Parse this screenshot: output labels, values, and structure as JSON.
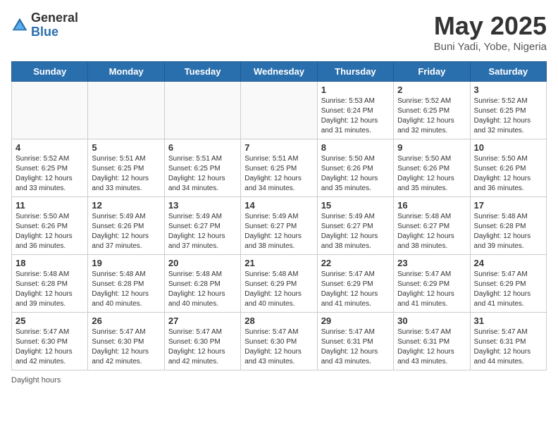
{
  "header": {
    "logo_general": "General",
    "logo_blue": "Blue",
    "month": "May 2025",
    "location": "Buni Yadi, Yobe, Nigeria"
  },
  "weekdays": [
    "Sunday",
    "Monday",
    "Tuesday",
    "Wednesday",
    "Thursday",
    "Friday",
    "Saturday"
  ],
  "weeks": [
    [
      {
        "day": "",
        "info": ""
      },
      {
        "day": "",
        "info": ""
      },
      {
        "day": "",
        "info": ""
      },
      {
        "day": "",
        "info": ""
      },
      {
        "day": "1",
        "info": "Sunrise: 5:53 AM\nSunset: 6:24 PM\nDaylight: 12 hours and 31 minutes."
      },
      {
        "day": "2",
        "info": "Sunrise: 5:52 AM\nSunset: 6:25 PM\nDaylight: 12 hours and 32 minutes."
      },
      {
        "day": "3",
        "info": "Sunrise: 5:52 AM\nSunset: 6:25 PM\nDaylight: 12 hours and 32 minutes."
      }
    ],
    [
      {
        "day": "4",
        "info": "Sunrise: 5:52 AM\nSunset: 6:25 PM\nDaylight: 12 hours and 33 minutes."
      },
      {
        "day": "5",
        "info": "Sunrise: 5:51 AM\nSunset: 6:25 PM\nDaylight: 12 hours and 33 minutes."
      },
      {
        "day": "6",
        "info": "Sunrise: 5:51 AM\nSunset: 6:25 PM\nDaylight: 12 hours and 34 minutes."
      },
      {
        "day": "7",
        "info": "Sunrise: 5:51 AM\nSunset: 6:25 PM\nDaylight: 12 hours and 34 minutes."
      },
      {
        "day": "8",
        "info": "Sunrise: 5:50 AM\nSunset: 6:26 PM\nDaylight: 12 hours and 35 minutes."
      },
      {
        "day": "9",
        "info": "Sunrise: 5:50 AM\nSunset: 6:26 PM\nDaylight: 12 hours and 35 minutes."
      },
      {
        "day": "10",
        "info": "Sunrise: 5:50 AM\nSunset: 6:26 PM\nDaylight: 12 hours and 36 minutes."
      }
    ],
    [
      {
        "day": "11",
        "info": "Sunrise: 5:50 AM\nSunset: 6:26 PM\nDaylight: 12 hours and 36 minutes."
      },
      {
        "day": "12",
        "info": "Sunrise: 5:49 AM\nSunset: 6:26 PM\nDaylight: 12 hours and 37 minutes."
      },
      {
        "day": "13",
        "info": "Sunrise: 5:49 AM\nSunset: 6:27 PM\nDaylight: 12 hours and 37 minutes."
      },
      {
        "day": "14",
        "info": "Sunrise: 5:49 AM\nSunset: 6:27 PM\nDaylight: 12 hours and 38 minutes."
      },
      {
        "day": "15",
        "info": "Sunrise: 5:49 AM\nSunset: 6:27 PM\nDaylight: 12 hours and 38 minutes."
      },
      {
        "day": "16",
        "info": "Sunrise: 5:48 AM\nSunset: 6:27 PM\nDaylight: 12 hours and 38 minutes."
      },
      {
        "day": "17",
        "info": "Sunrise: 5:48 AM\nSunset: 6:28 PM\nDaylight: 12 hours and 39 minutes."
      }
    ],
    [
      {
        "day": "18",
        "info": "Sunrise: 5:48 AM\nSunset: 6:28 PM\nDaylight: 12 hours and 39 minutes."
      },
      {
        "day": "19",
        "info": "Sunrise: 5:48 AM\nSunset: 6:28 PM\nDaylight: 12 hours and 40 minutes."
      },
      {
        "day": "20",
        "info": "Sunrise: 5:48 AM\nSunset: 6:28 PM\nDaylight: 12 hours and 40 minutes."
      },
      {
        "day": "21",
        "info": "Sunrise: 5:48 AM\nSunset: 6:29 PM\nDaylight: 12 hours and 40 minutes."
      },
      {
        "day": "22",
        "info": "Sunrise: 5:47 AM\nSunset: 6:29 PM\nDaylight: 12 hours and 41 minutes."
      },
      {
        "day": "23",
        "info": "Sunrise: 5:47 AM\nSunset: 6:29 PM\nDaylight: 12 hours and 41 minutes."
      },
      {
        "day": "24",
        "info": "Sunrise: 5:47 AM\nSunset: 6:29 PM\nDaylight: 12 hours and 41 minutes."
      }
    ],
    [
      {
        "day": "25",
        "info": "Sunrise: 5:47 AM\nSunset: 6:30 PM\nDaylight: 12 hours and 42 minutes."
      },
      {
        "day": "26",
        "info": "Sunrise: 5:47 AM\nSunset: 6:30 PM\nDaylight: 12 hours and 42 minutes."
      },
      {
        "day": "27",
        "info": "Sunrise: 5:47 AM\nSunset: 6:30 PM\nDaylight: 12 hours and 42 minutes."
      },
      {
        "day": "28",
        "info": "Sunrise: 5:47 AM\nSunset: 6:30 PM\nDaylight: 12 hours and 43 minutes."
      },
      {
        "day": "29",
        "info": "Sunrise: 5:47 AM\nSunset: 6:31 PM\nDaylight: 12 hours and 43 minutes."
      },
      {
        "day": "30",
        "info": "Sunrise: 5:47 AM\nSunset: 6:31 PM\nDaylight: 12 hours and 43 minutes."
      },
      {
        "day": "31",
        "info": "Sunrise: 5:47 AM\nSunset: 6:31 PM\nDaylight: 12 hours and 44 minutes."
      }
    ]
  ],
  "footer": {
    "note": "Daylight hours"
  }
}
